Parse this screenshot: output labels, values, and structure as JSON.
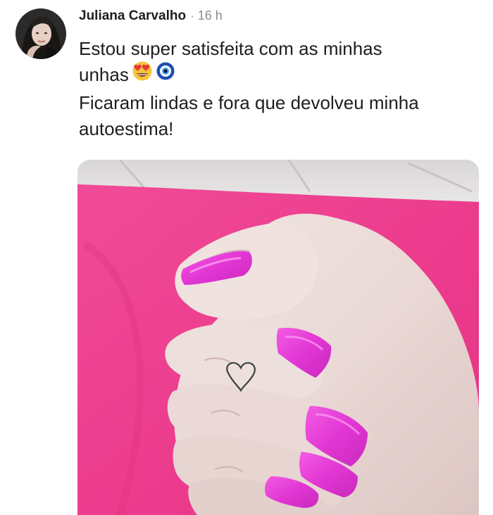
{
  "post": {
    "author": "Juliana Carvalho",
    "separator": "·",
    "time": "16 h",
    "text_lines": [
      "Estou super satisfeita com as minhas",
      "unhas",
      "Ficaram lindas e fora que devolveu minha",
      "autoestima!"
    ],
    "emojis": [
      "heart-eyes-emoji",
      "nazar-amulet-emoji"
    ],
    "photo_icon": "pink-nails-hand-photo"
  },
  "colors": {
    "text": "#1c1e21",
    "secondary_text": "#8a8d91",
    "background": "#ffffff",
    "nail_pink": "#e93ad6",
    "backdrop_pink": "#ee3f93"
  }
}
